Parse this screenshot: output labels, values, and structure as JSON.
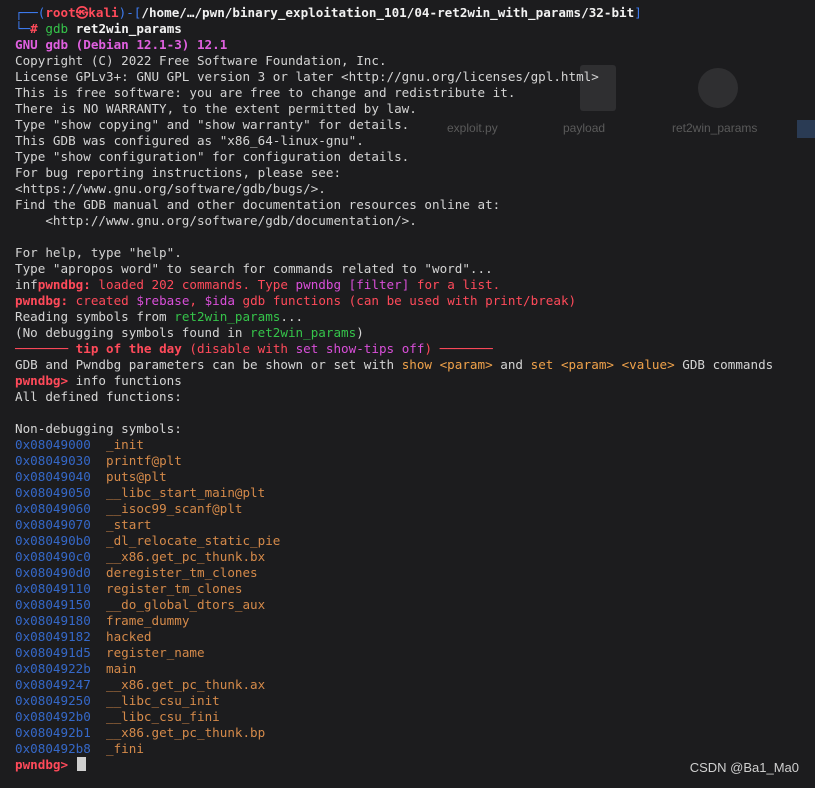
{
  "prompt": {
    "user": "root",
    "skull": "㉿",
    "host": "kali",
    "path": "/home/…/pwn/binary_exploitation_101/04-ret2win_with_params/32-bit",
    "hash": "#",
    "cmd_gdb": "gdb",
    "cmd_arg": "ret2win_params"
  },
  "intro": {
    "version": "GNU gdb (Debian 12.1-3) 12.1",
    "lines": [
      "Copyright (C) 2022 Free Software Foundation, Inc.",
      "License GPLv3+: GNU GPL version 3 or later <http://gnu.org/licenses/gpl.html>",
      "This is free software: you are free to change and redistribute it.",
      "There is NO WARRANTY, to the extent permitted by law.",
      "Type \"show copying\" and \"show warranty\" for details.",
      "This GDB was configured as \"x86_64-linux-gnu\".",
      "Type \"show configuration\" for configuration details.",
      "For bug reporting instructions, please see:",
      "<https://www.gnu.org/software/gdb/bugs/>.",
      "Find the GDB manual and other documentation resources online at:",
      "    <http://www.gnu.org/software/gdb/documentation/>.",
      "",
      "For help, type \"help\".",
      "Type \"apropos word\" to search for commands related to \"word\"..."
    ]
  },
  "pwndbg": {
    "prefix": "pwndbg:",
    "inf_prefix": "inf",
    "loaded_a": " loaded 202 commands. Type ",
    "loaded_b": "pwndbg [filter]",
    "loaded_c": " for a list.",
    "created_a": " created ",
    "created_b": "$rebase",
    "created_c": ", ",
    "created_d": "$ida",
    "created_e": " gdb functions (can be used with print/break)",
    "reading_a": "Reading symbols from ",
    "reading_b": "ret2win_params",
    "reading_c": "...",
    "nodebug_a": "(No debugging symbols found in ",
    "nodebug_b": "ret2win_params",
    "nodebug_c": ")",
    "tip_dash": "───────",
    "tip_title": "tip of the day",
    "tip_a": " (disable with ",
    "tip_b": "set show-tips off",
    "tip_c": ") ",
    "tip_body_a": "GDB and Pwndbg parameters can be shown or set with ",
    "tip_body_b": "show <param>",
    "tip_body_c": " and ",
    "tip_body_d": "set <param> <value>",
    "tip_body_e": " GDB commands",
    "cmd_info": " info functions",
    "all_defined": "All defined functions:",
    "non_debug": "Non-debugging symbols:",
    "final_prompt": "pwndbg>"
  },
  "functions": [
    {
      "addr": "0x08049000",
      "name": "_init"
    },
    {
      "addr": "0x08049030",
      "name": "printf@plt"
    },
    {
      "addr": "0x08049040",
      "name": "puts@plt"
    },
    {
      "addr": "0x08049050",
      "name": "__libc_start_main@plt"
    },
    {
      "addr": "0x08049060",
      "name": "__isoc99_scanf@plt"
    },
    {
      "addr": "0x08049070",
      "name": "_start"
    },
    {
      "addr": "0x080490b0",
      "name": "_dl_relocate_static_pie"
    },
    {
      "addr": "0x080490c0",
      "name": "__x86.get_pc_thunk.bx"
    },
    {
      "addr": "0x080490d0",
      "name": "deregister_tm_clones"
    },
    {
      "addr": "0x08049110",
      "name": "register_tm_clones"
    },
    {
      "addr": "0x08049150",
      "name": "__do_global_dtors_aux"
    },
    {
      "addr": "0x08049180",
      "name": "frame_dummy"
    },
    {
      "addr": "0x08049182",
      "name": "hacked"
    },
    {
      "addr": "0x080491d5",
      "name": "register_name"
    },
    {
      "addr": "0x0804922b",
      "name": "main"
    },
    {
      "addr": "0x08049247",
      "name": "__x86.get_pc_thunk.ax"
    },
    {
      "addr": "0x08049250",
      "name": "__libc_csu_init"
    },
    {
      "addr": "0x080492b0",
      "name": "__libc_csu_fini"
    },
    {
      "addr": "0x080492b1",
      "name": "__x86.get_pc_thunk.bp"
    },
    {
      "addr": "0x080492b8",
      "name": "_fini"
    }
  ],
  "background": {
    "file1": "exploit.py",
    "file2": "payload",
    "file3": "ret2win_params"
  },
  "watermark": "CSDN @Ba1_Ma0"
}
